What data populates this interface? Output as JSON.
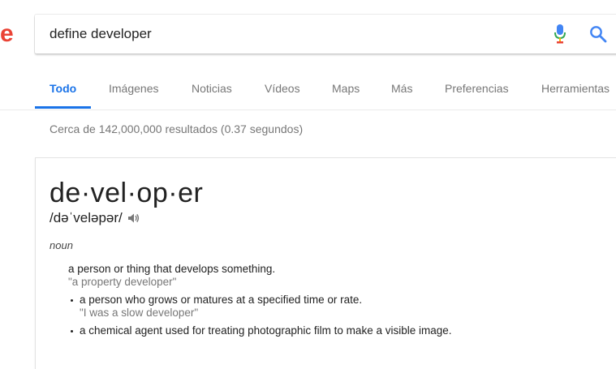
{
  "logo": {
    "fragment": "e",
    "color": "#ea4335"
  },
  "search": {
    "query": "define developer"
  },
  "tabs": [
    {
      "label": "Todo",
      "active": true
    },
    {
      "label": "Imágenes"
    },
    {
      "label": "Noticias"
    },
    {
      "label": "Vídeos"
    },
    {
      "label": "Maps"
    },
    {
      "label": "Más"
    },
    {
      "label": "Preferencias"
    },
    {
      "label": "Herramientas"
    }
  ],
  "results": {
    "count_text": "Cerca de 142,000,000 resultados (0.37 segundos)"
  },
  "dictionary": {
    "headword": "de·vel·op·er",
    "phonetic": "/dəˈveləpər/",
    "part_of_speech": "noun",
    "senses": [
      {
        "definition": "a person or thing that develops something.",
        "example": "\"a property developer\""
      },
      {
        "definition": "a person who grows or matures at a specified time or rate.",
        "example": "\"I was a slow developer\""
      },
      {
        "definition": "a chemical agent used for treating photographic film to make a visible image."
      }
    ]
  },
  "colors": {
    "accent": "#1a73e8",
    "mic_blue": "#4285f4",
    "mic_red": "#ea4335",
    "mic_yellow": "#fbbc05",
    "mic_green": "#34a853"
  }
}
